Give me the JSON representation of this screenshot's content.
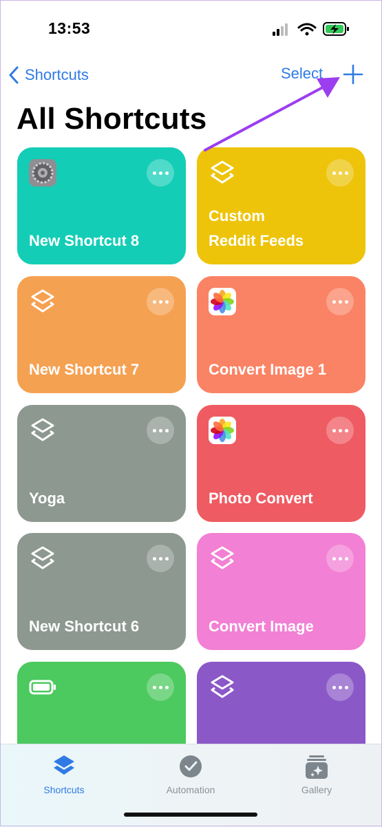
{
  "status_bar": {
    "time": "13:53"
  },
  "nav": {
    "back_label": "Shortcuts",
    "select_label": "Select"
  },
  "page": {
    "title": "All Shortcuts"
  },
  "tiles": [
    {
      "label": "New Shortcut 8",
      "icon": "settings-app-icon",
      "color": "#14cdb6"
    },
    {
      "label": "Custom\nReddit Feeds",
      "icon": "shortcuts-layers-icon",
      "color": "#edc40a"
    },
    {
      "label": "New Shortcut 7",
      "icon": "shortcuts-layers-icon",
      "color": "#f5a152"
    },
    {
      "label": "Convert Image 1",
      "icon": "photos-app-icon",
      "color": "#fa8365"
    },
    {
      "label": "Yoga",
      "icon": "shortcuts-layers-icon",
      "color": "#8d9891"
    },
    {
      "label": "Photo Convert",
      "icon": "photos-app-icon",
      "color": "#ef5b62"
    },
    {
      "label": "New Shortcut 6",
      "icon": "shortcuts-layers-icon",
      "color": "#8d9891"
    },
    {
      "label": "Convert Image",
      "icon": "shortcuts-layers-icon",
      "color": "#f280d4"
    },
    {
      "label": "",
      "icon": "battery-icon",
      "color": "#4cc95f"
    },
    {
      "label": "",
      "icon": "shortcuts-layers-icon",
      "color": "#8b58c8"
    }
  ],
  "tabbar": {
    "tabs": [
      {
        "label": "Shortcuts",
        "icon": "shortcuts-layers-icon",
        "active": true
      },
      {
        "label": "Automation",
        "icon": "clock-check-icon",
        "active": false
      },
      {
        "label": "Gallery",
        "icon": "gallery-sparkle-icon",
        "active": false
      }
    ]
  },
  "colors": {
    "accent": "#2f7ae5",
    "annotation": "#9b3ef0"
  }
}
